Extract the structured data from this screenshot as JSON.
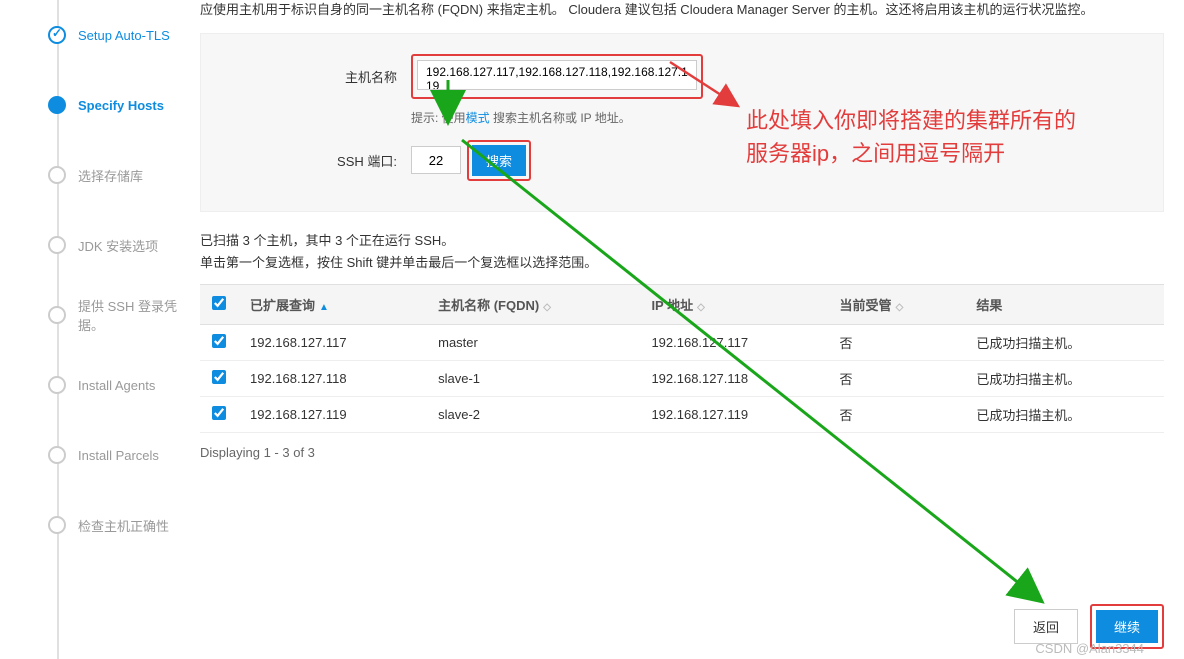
{
  "intro": "应使用主机用于标识自身的同一主机名称 (FQDN) 来指定主机。 Cloudera 建议包括 Cloudera Manager Server 的主机。这还将启用该主机的运行状况监控。",
  "sidebar": {
    "steps": [
      {
        "label": "Setup Auto-TLS",
        "state": "done"
      },
      {
        "label": "Specify Hosts",
        "state": "active"
      },
      {
        "label": "选择存储库",
        "state": "pending"
      },
      {
        "label": "JDK 安装选项",
        "state": "pending"
      },
      {
        "label": "提供 SSH 登录凭据。",
        "state": "pending"
      },
      {
        "label": "Install Agents",
        "state": "pending"
      },
      {
        "label": "Install Parcels",
        "state": "pending"
      },
      {
        "label": "检查主机正确性",
        "state": "pending"
      }
    ]
  },
  "form": {
    "hostnames_label": "主机名称",
    "hostnames_value": "192.168.127.117,192.168.127.118,192.168.127.119",
    "hint_prefix": "提示: 使用",
    "hint_link": "模式 ",
    "hint_suffix": "搜索主机名称或 IP 地址。",
    "ssh_port_label": "SSH 端口:",
    "ssh_port_value": "22",
    "search_label": "搜索"
  },
  "scan": {
    "line1": "已扫描 3 个主机，其中 3 个正在运行 SSH。",
    "line2": "单击第一个复选框，按住 Shift 键并单击最后一个复选框以选择范围。"
  },
  "table": {
    "headers": {
      "expanded": "已扩展查询",
      "fqdn": "主机名称 (FQDN)",
      "ip": "IP 地址",
      "managed": "当前受管",
      "result": "结果"
    },
    "rows": [
      {
        "query": "192.168.127.117",
        "fqdn": "master",
        "ip": "192.168.127.117",
        "managed": "否",
        "result": "已成功扫描主机。"
      },
      {
        "query": "192.168.127.118",
        "fqdn": "slave-1",
        "ip": "192.168.127.118",
        "managed": "否",
        "result": "已成功扫描主机。"
      },
      {
        "query": "192.168.127.119",
        "fqdn": "slave-2",
        "ip": "192.168.127.119",
        "managed": "否",
        "result": "已成功扫描主机。"
      }
    ],
    "display": "Displaying 1 - 3 of 3"
  },
  "annotation": {
    "line1": "此处填入你即将搭建的集群所有的",
    "line2": "服务器ip，之间用逗号隔开"
  },
  "footer": {
    "back": "返回",
    "continue": "继续"
  },
  "watermark": "CSDN @Alan3344",
  "colors": {
    "accent": "#0d8ce0",
    "anno": "#e23c3c",
    "green": "#1aa61a"
  }
}
